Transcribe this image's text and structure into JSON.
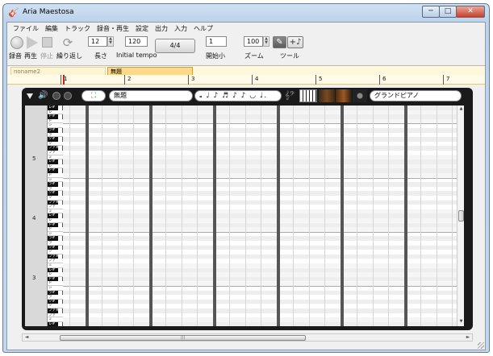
{
  "window": {
    "title": "Aria Maestosa",
    "minimize": "─",
    "maximize": "□",
    "close": "✕"
  },
  "menu": [
    "ファイル",
    "編集",
    "トラック",
    "録音・再生",
    "設定",
    "出力",
    "入力",
    "ヘルプ"
  ],
  "toolbar": {
    "record_label": "録音",
    "play_label": "再生",
    "stop_label": "停止",
    "loop_label": "繰り返し",
    "length_value": "12",
    "length_label": "長さ",
    "tempo_value": "120",
    "tempo_label": "Initial tempo",
    "time_signature": "4/4",
    "start_measure_value": "1",
    "start_measure_label": "開始小",
    "zoom_value": "100",
    "zoom_label": "ズーム",
    "tool_label": "ツール",
    "pencil_glyph": "✎",
    "add_note_glyph": "+♪"
  },
  "sequences": {
    "tab_inactive": "noname2",
    "tab_active": "無題"
  },
  "measures": [
    "1",
    "2",
    "3",
    "4",
    "5",
    "6",
    "7"
  ],
  "track": {
    "collapse_glyph": "▼",
    "volume_glyph": "🔊",
    "dock_glyph": "⛶",
    "name": "無題",
    "durations": "𝅝 ♩ ♪ ♬ ♪ ♪ ◡ ♩.",
    "duration_stepper": "▲▼",
    "clef_glyph": "𝄞𝄢",
    "instrument": "グランドピアノ"
  },
  "keyboard": {
    "octave_numbers": [
      "5",
      "4",
      "3"
    ],
    "note_names": [
      "シ",
      "ラ#",
      "ラ",
      "ソ#",
      "ソ",
      "ファ#",
      "ファ",
      "ミ",
      "レ#",
      "レ",
      "ド#",
      "ド"
    ]
  },
  "scroll": {
    "up": "▲",
    "down": "▼",
    "left": "◄",
    "right": "►",
    "grip": "|||"
  }
}
